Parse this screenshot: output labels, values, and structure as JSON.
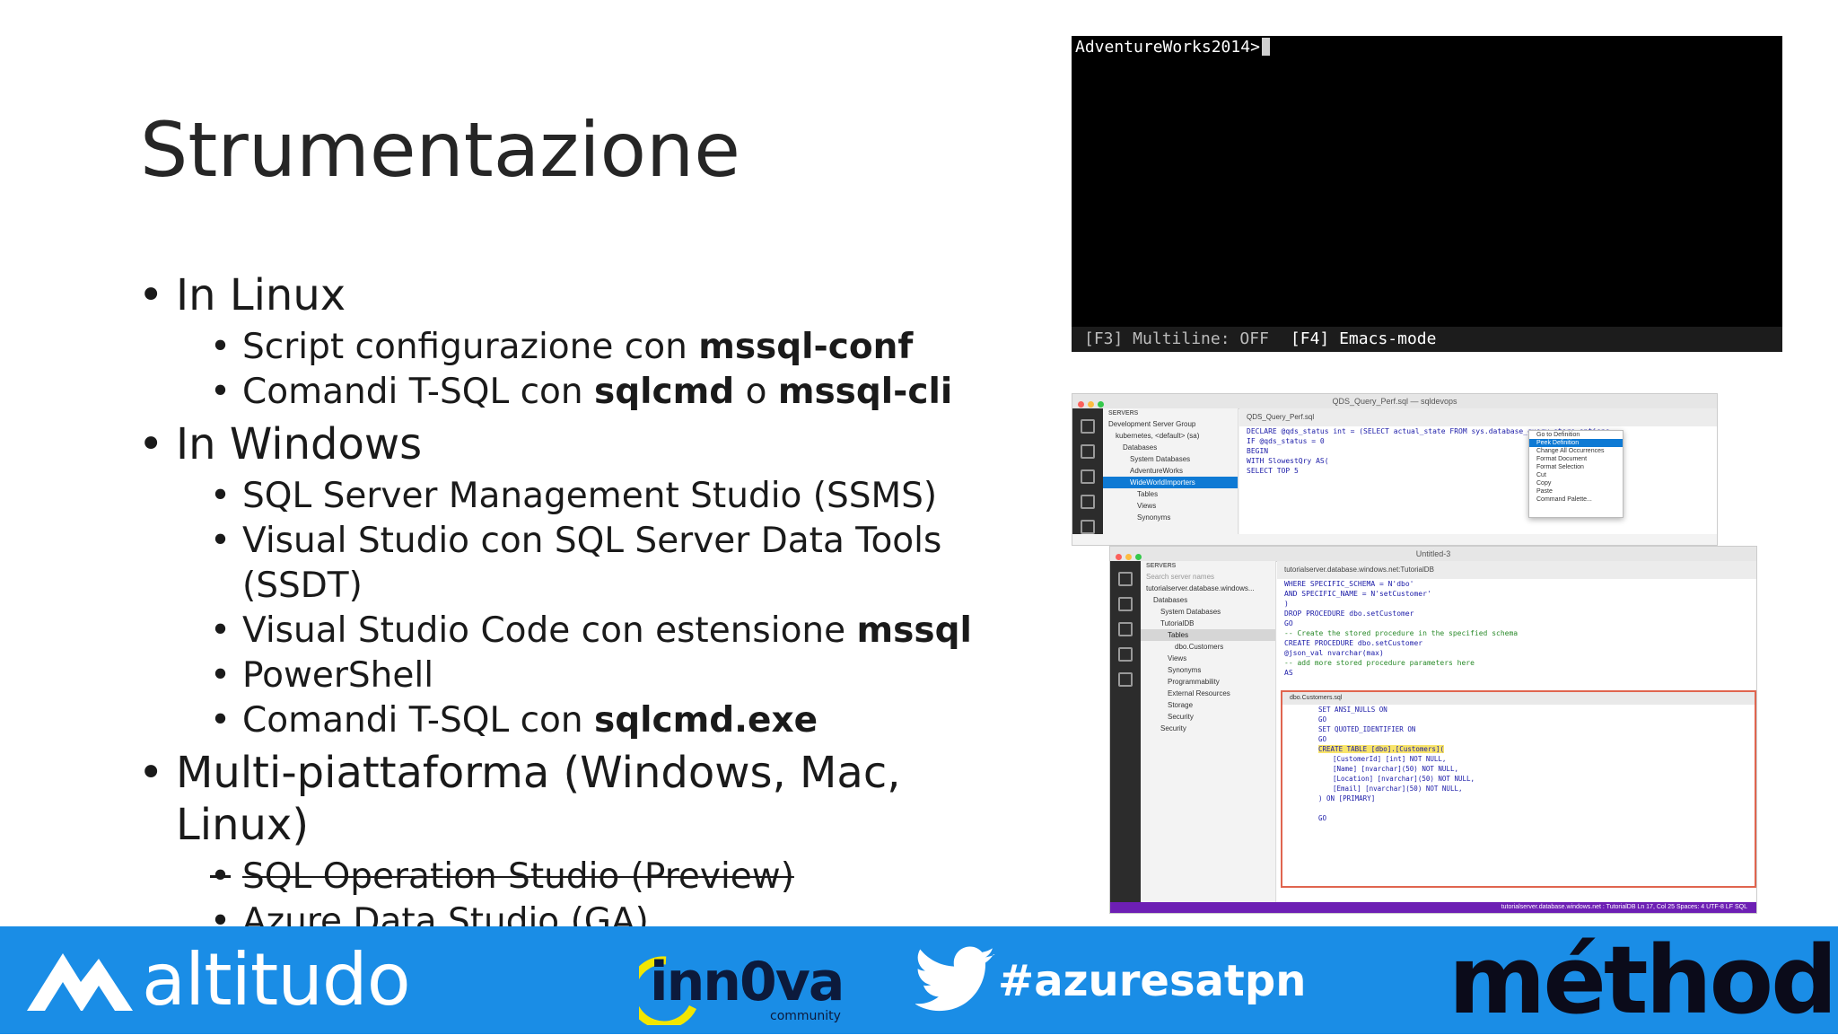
{
  "slide": {
    "title": "Strumentazione",
    "sections": [
      {
        "label": "In Linux",
        "items": [
          {
            "pre": "Script configurazione con ",
            "bold": "mssql-conf",
            "mid": "",
            "bold2": ""
          },
          {
            "pre": "Comandi T-SQL con ",
            "bold": "sqlcmd",
            "mid": " o ",
            "bold2": "mssql-cli"
          }
        ]
      },
      {
        "label": "In Windows",
        "items": [
          {
            "pre": "SQL Server Management Studio (SSMS)"
          },
          {
            "pre": "Visual Studio con SQL Server Data Tools (SSDT)"
          },
          {
            "pre": "Visual Studio Code con estensione ",
            "bold": "mssql"
          },
          {
            "pre": "PowerShell"
          },
          {
            "pre": "Comandi T-SQL con ",
            "bold": "sqlcmd.exe"
          }
        ]
      },
      {
        "label": "Multi-piattaforma (Windows, Mac, Linux)",
        "items": [
          {
            "pre": "SQL Operation Studio (Preview)",
            "strike": true
          },
          {
            "pre": "Azure Data Studio (GA)"
          }
        ]
      }
    ]
  },
  "terminal": {
    "prompt": "AdventureWorks2014>",
    "status_multiline": "[F3] Multiline: OFF",
    "status_mode": "[F4] Emacs-mode"
  },
  "editor_top": {
    "window_title": "QDS_Query_Perf.sql — sqldevops",
    "tab": "QDS_Query_Perf.sql",
    "sidebar": [
      "SERVERS",
      "Development Server Group",
      "kubernetes, <default> (sa)",
      "Databases",
      "System Databases",
      "AdventureWorks",
      "WideWorldImporters",
      "Tables",
      "Views",
      "Synonyms"
    ],
    "code": [
      "DECLARE @qds_status int = (SELECT actual_state FROM sys.database_query_store_options",
      "IF @qds_status = 0",
      "BEGIN",
      "WITH SlowestQry AS(",
      "SELECT TOP 5"
    ],
    "menu": [
      "Go to Definition",
      "Peek Definition",
      "Change All Occurrences",
      "Format Document",
      "Format Selection",
      "Cut",
      "Copy",
      "Paste",
      "Command Palette..."
    ]
  },
  "editor_bottom": {
    "window_title": "Untitled-3",
    "tab": "tutorialserver.database.windows.net:TutorialDB",
    "sidebar": [
      "SERVERS",
      "Search server names",
      "tutorialserver.database.windows...",
      "Databases",
      "System Databases",
      "TutorialDB",
      "Tables",
      "dbo.Customers",
      "Views",
      "Synonyms",
      "Programmability",
      "External Resources",
      "Storage",
      "Security",
      "Security"
    ],
    "code": [
      "WHERE SPECIFIC_SCHEMA = N'dbo'",
      "AND SPECIFIC_NAME = N'setCustomer'",
      ")",
      "DROP PROCEDURE dbo.setCustomer",
      "GO",
      "-- Create the stored procedure in the specified schema",
      "CREATE PROCEDURE dbo.setCustomer",
      "@json_val nvarchar(max)",
      "-- add more stored procedure parameters here",
      "AS"
    ],
    "peek_title": "dbo.Customers.sql",
    "peek_code": [
      "SET ANSI_NULLS ON",
      "GO",
      "SET QUOTED_IDENTIFIER ON",
      "GO",
      "CREATE TABLE [dbo].[Customers](",
      "[CustomerId] [int] NOT NULL,",
      "[Name] [nvarchar](50) NOT NULL,",
      "[Location] [nvarchar](50) NOT NULL,",
      "[Email] [nvarchar](50) NOT NULL,",
      ") ON [PRIMARY]",
      "",
      "GO"
    ],
    "status": "tutorialserver.database.windows.net : TutorialDB   Ln 17, Col 25   Spaces: 4   UTF-8   LF   SQL"
  },
  "footer": {
    "altitudo": "altitudo",
    "innova": "inn0va",
    "innova_sub": "community",
    "hashtag": "#azuresatpn",
    "methode": "méthode"
  },
  "colors": {
    "footer_bg": "#1a8de6",
    "methode": "#0b0b1a",
    "peek_border": "#e0654f"
  }
}
